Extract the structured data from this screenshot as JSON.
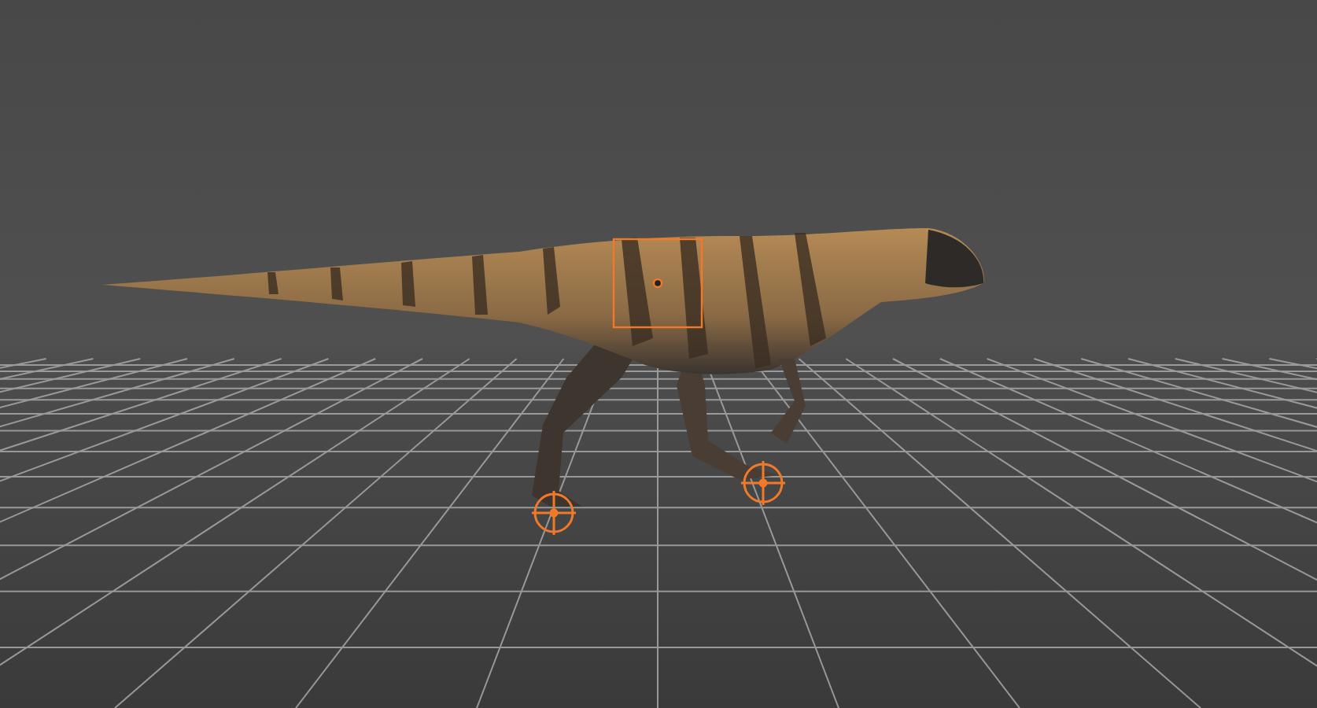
{
  "viewport": {
    "grid": true
  },
  "rig_controls": [
    {
      "kind": "box"
    },
    {
      "kind": "target"
    },
    {
      "kind": "target"
    }
  ]
}
